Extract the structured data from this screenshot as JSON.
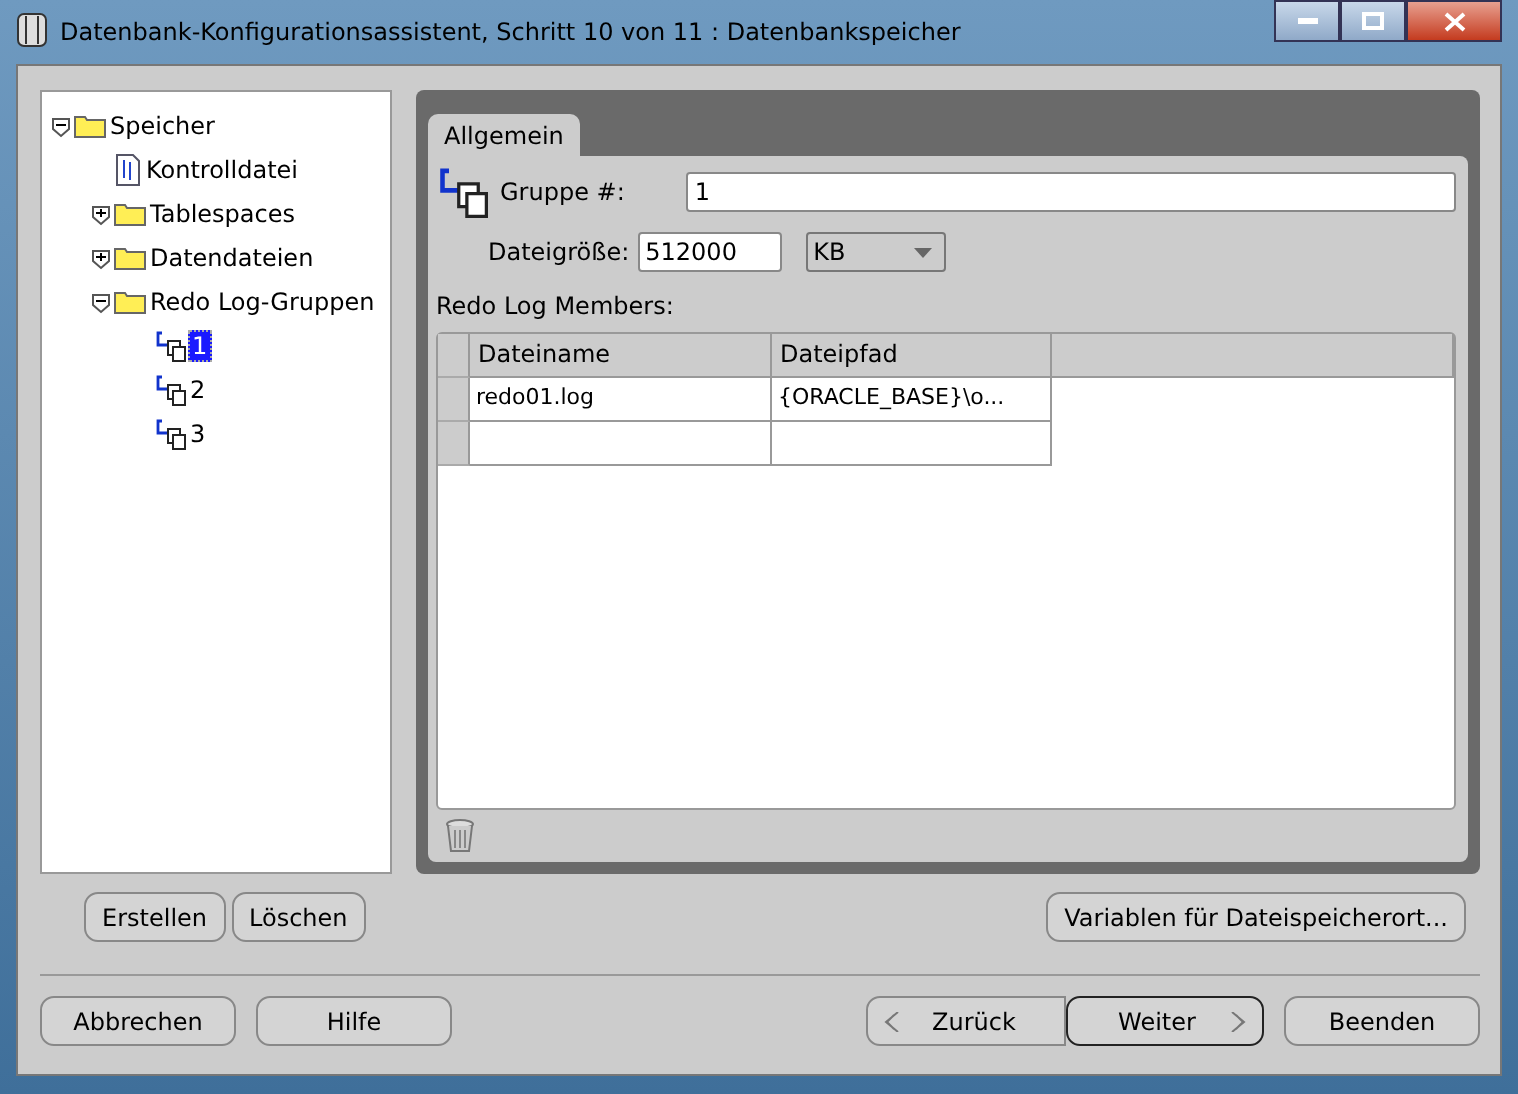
{
  "window": {
    "title": "Datenbank-Konfigurationsassistent, Schritt 10 von 11 : Datenbankspeicher"
  },
  "tree": [
    {
      "label": "Speicher",
      "kind": "folder",
      "expanded": true,
      "selected": false,
      "children": [
        {
          "label": "Kontrolldatei",
          "kind": "file",
          "selected": false
        },
        {
          "label": "Tablespaces",
          "kind": "folder",
          "expanded": false,
          "selected": false
        },
        {
          "label": "Datendateien",
          "kind": "folder",
          "expanded": false,
          "selected": false
        },
        {
          "label": "Redo Log-Gruppen",
          "kind": "folder",
          "expanded": true,
          "selected": false,
          "children": [
            {
              "label": "1",
              "kind": "group",
              "selected": true
            },
            {
              "label": "2",
              "kind": "group",
              "selected": false
            },
            {
              "label": "3",
              "kind": "group",
              "selected": false
            }
          ]
        }
      ]
    }
  ],
  "tabs": [
    {
      "label": "Allgemein",
      "selected": true
    }
  ],
  "form": {
    "group_label": "Gruppe #:",
    "group_value": "1",
    "size_label": "Dateigröße:",
    "size_value": "512000",
    "unit": "KB"
  },
  "members_label": "Redo Log Members:",
  "table": {
    "columns": [
      "Dateiname",
      "Dateipfad"
    ],
    "rows": [
      [
        "redo01.log",
        "{ORACLE_BASE}\\o..."
      ],
      [
        "",
        ""
      ]
    ]
  },
  "tree_buttons": [
    "Erstellen",
    "Löschen"
  ],
  "variables_button": "Variablen für Dateispeicherort...",
  "footer_buttons": [
    {
      "label": "Abbrechen",
      "kind": "plain"
    },
    {
      "label": "Hilfe",
      "kind": "plain"
    },
    {
      "label": "Zurück",
      "kind": "back"
    },
    {
      "label": "Weiter",
      "kind": "next"
    },
    {
      "label": "Beenden",
      "kind": "plain"
    }
  ]
}
